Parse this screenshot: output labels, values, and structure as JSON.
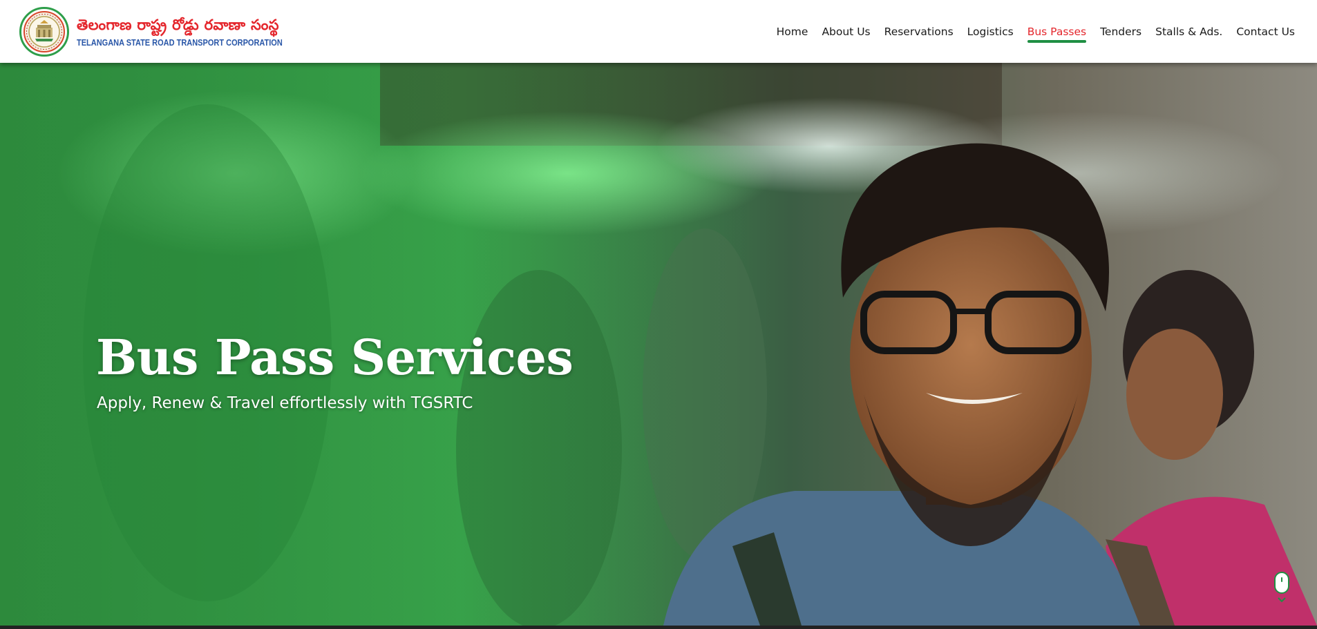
{
  "header": {
    "brand_telugu": "తెలంగాణ రాష్ట్ర రోడ్డు రవాణా సంస్థ",
    "brand_english": "TELANGANA STATE ROAD TRANSPORT CORPORATION",
    "logo_icon": "tgsrtc-emblem-icon"
  },
  "nav": {
    "items": [
      {
        "label": "Home",
        "active": false
      },
      {
        "label": "About Us",
        "active": false
      },
      {
        "label": "Reservations",
        "active": false
      },
      {
        "label": "Logistics",
        "active": false
      },
      {
        "label": "Bus Passes",
        "active": true
      },
      {
        "label": "Tenders",
        "active": false
      },
      {
        "label": "Stalls & Ads.",
        "active": false
      },
      {
        "label": "Contact Us",
        "active": false
      }
    ]
  },
  "hero": {
    "title": "Bus Pass Services",
    "subtitle": "Apply, Renew & Travel effortlessly with TGSRTC",
    "scroll_icon": "scroll-down-mouse-icon"
  },
  "colors": {
    "brand_red": "#e4262c",
    "brand_blue": "#2a57a8",
    "accent_green": "#1f8f43",
    "overlay_green": "#3fbf5a"
  }
}
